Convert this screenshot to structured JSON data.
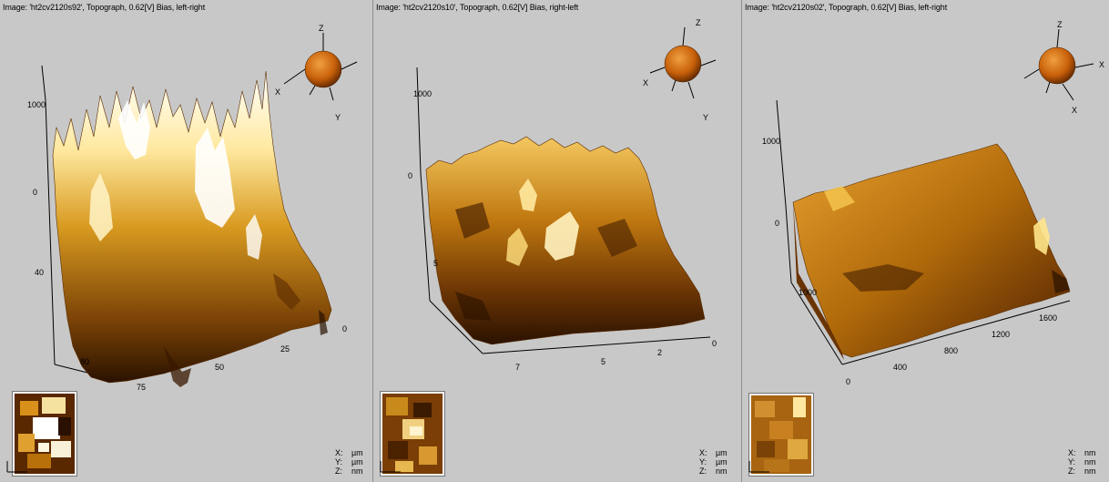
{
  "panels": [
    {
      "title": "Image: 'ht2cv2120s92', Topograph, 0.62[V] Bias, left-right",
      "z_ticks": [
        "1000",
        "0"
      ],
      "y_ticks": [
        "40",
        "80"
      ],
      "x_ticks": [
        "75",
        "50",
        "25",
        "0"
      ],
      "axis_labels": {
        "z": "Z",
        "x": "X",
        "y": "Y"
      },
      "units": {
        "x": "µm",
        "y": "µm",
        "z": "nm"
      }
    },
    {
      "title": "Image: 'ht2cv2120s10', Topograph, 0.62[V] Bias, right-left",
      "z_ticks": [
        "1000",
        "0"
      ],
      "y_ticks": [
        "5"
      ],
      "x_ticks": [
        "7",
        "5",
        "2",
        "0"
      ],
      "axis_labels": {
        "z": "Z",
        "x": "X",
        "y": "Y"
      },
      "units": {
        "x": "µm",
        "y": "µm",
        "z": "nm"
      }
    },
    {
      "title": "Image: 'ht2cv2120s02', Topograph, 0.62[V] Bias, left-right",
      "z_ticks": [
        "1000",
        "0"
      ],
      "y_ticks": [
        "1000"
      ],
      "x_ticks": [
        "0",
        "400",
        "800",
        "1200",
        "1600"
      ],
      "axis_labels": {
        "z": "Z",
        "x": "X",
        "y": "X"
      },
      "units": {
        "x": "nm",
        "y": "nm",
        "z": "nm"
      }
    }
  ],
  "unit_keys": {
    "x": "X:",
    "y": "Y:",
    "z": "Z:"
  },
  "colors": {
    "background": "#c8c8c8",
    "surface_dark": "#3a1a00",
    "surface_mid": "#b8700a",
    "surface_light": "#f0c040",
    "surface_peak": "#ffffff"
  },
  "icons": [
    "orientation-sphere-icon",
    "axis-corner-icon"
  ]
}
